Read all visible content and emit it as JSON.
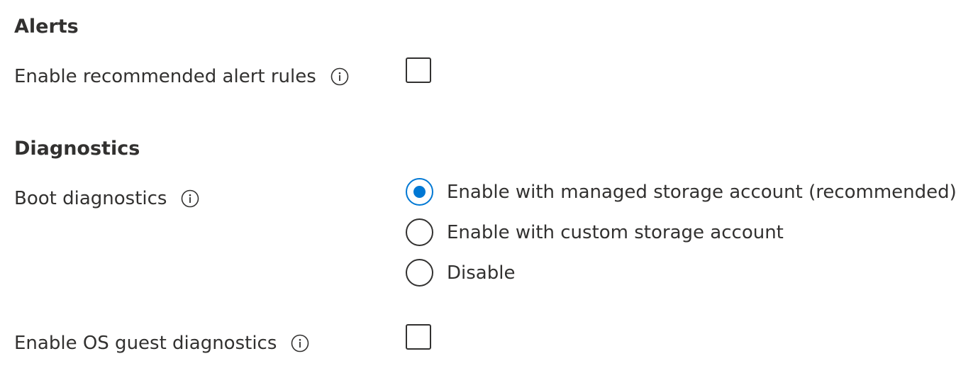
{
  "alerts": {
    "heading": "Alerts",
    "recommended_alert_rules": {
      "label": "Enable recommended alert rules",
      "checked": false
    }
  },
  "diagnostics": {
    "heading": "Diagnostics",
    "boot_diagnostics": {
      "label": "Boot diagnostics",
      "selected": "managed",
      "options": [
        {
          "id": "managed",
          "label": "Enable with managed storage account (recommended)",
          "checked": true
        },
        {
          "id": "custom",
          "label": "Enable with custom storage account",
          "checked": false
        },
        {
          "id": "disable",
          "label": "Disable",
          "checked": false
        }
      ]
    },
    "os_guest_diagnostics": {
      "label": "Enable OS guest diagnostics",
      "checked": false
    }
  },
  "colors": {
    "accent": "#0078d4",
    "text": "#323130",
    "border": "#323130"
  },
  "icons": {
    "info": "info-circle-icon"
  }
}
